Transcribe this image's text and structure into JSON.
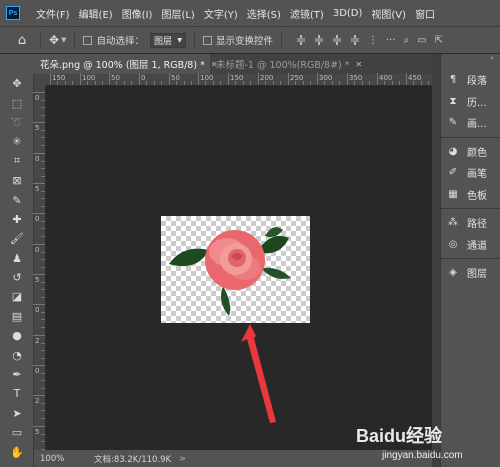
{
  "app": {
    "logo_text": "Ps"
  },
  "menu": [
    "文件(F)",
    "编辑(E)",
    "图像(I)",
    "图层(L)",
    "文字(Y)",
    "选择(S)",
    "滤镜(T)",
    "3D(D)",
    "视图(V)",
    "窗口"
  ],
  "options": {
    "auto_select_label": "自动选择：",
    "layer_select_value": "图层",
    "show_transform_label": "显示变换控件"
  },
  "tabs": [
    {
      "label": "花朵.png @ 100% (图层 1, RGB/8) *",
      "active": true
    },
    {
      "label": "未标题-1 @ 100%(RGB/8#) *",
      "active": false
    }
  ],
  "ruler": {
    "top_labels": [
      "150",
      "100",
      "50",
      "0",
      "50",
      "100",
      "150",
      "200",
      "250",
      "300",
      "350",
      "400",
      "450"
    ],
    "left_labels": [
      "0",
      "5",
      "0",
      "5",
      "0",
      "0",
      "5",
      "0",
      "2",
      "0",
      "2",
      "5"
    ]
  },
  "status": {
    "zoom": "100%",
    "doc_info": "文档:83.2K/110.9K"
  },
  "panels": {
    "group1": [
      {
        "icon": "paragraph-icon",
        "label": "段落"
      },
      {
        "icon": "history-icon",
        "label": "历..."
      },
      {
        "icon": "brush-panel-icon",
        "label": "画..."
      }
    ],
    "group2": [
      {
        "icon": "palette-icon",
        "label": "颜色"
      },
      {
        "icon": "brush-settings-icon",
        "label": "画笔"
      },
      {
        "icon": "swatches-icon",
        "label": "色板"
      }
    ],
    "group3": [
      {
        "icon": "paths-icon",
        "label": "路径"
      },
      {
        "icon": "channels-icon",
        "label": "通道"
      }
    ],
    "group4": [
      {
        "icon": "layers-icon",
        "label": "图层"
      }
    ]
  },
  "watermark": {
    "brand": "Baidu经验",
    "url": "jingyan.baidu.com"
  },
  "colors": {
    "ui_bg": "#535353",
    "canvas_bg": "#282828",
    "arrow": "#e8383d",
    "rose": "#f07b7e",
    "leaf": "#1f4a1f"
  }
}
